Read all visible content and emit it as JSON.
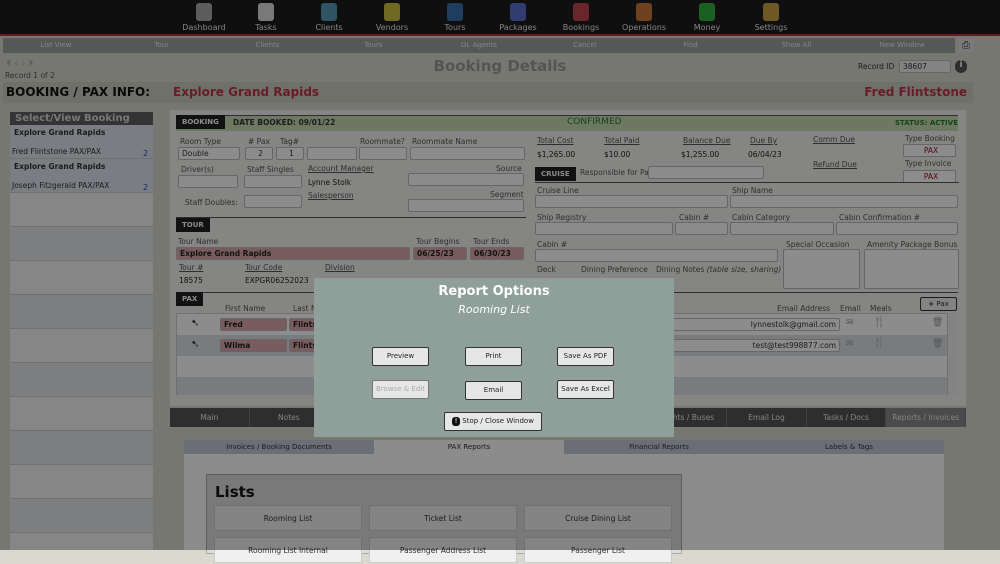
{
  "nav": [
    "Dashboard",
    "Tasks",
    "Clients",
    "Vendors",
    "Tours",
    "Packages",
    "Bookings",
    "Operations",
    "Money",
    "Settings"
  ],
  "nav_colors": [
    "#aaa",
    "#ddd",
    "#5a9ab8",
    "#c8c040",
    "#3a70a8",
    "#5a70c8",
    "#c04850",
    "#c87838",
    "#30b040",
    "#c8a040"
  ],
  "toolbar": [
    "List View",
    "Tour",
    "Clients",
    "Tours",
    "GL Agents",
    "Cancel",
    "Find",
    "Show All",
    "New Window"
  ],
  "page": {
    "title": "Booking Details",
    "record": "Record 1 of 2",
    "record_id_label": "Record ID",
    "record_id": "38607"
  },
  "band": {
    "label": "BOOKING / PAX INFO:",
    "tour": "Explore Grand Rapids",
    "client": "Fred Flintstone"
  },
  "sidebar": {
    "title": "Select/View Booking",
    "items": [
      {
        "tour": "Explore Grand Rapids",
        "name": "Fred Flintstone  PAX/PAX",
        "count": "2"
      },
      {
        "tour": "Explore Grand Rapids",
        "name": "Joseph Fitzgerald  PAX/PAX",
        "count": "2"
      }
    ]
  },
  "booking": {
    "tag": "BOOKING",
    "date_booked": "DATE BOOKED: 09/01/22",
    "confirmed": "CONFIRMED",
    "status": "STATUS: ACTIVE",
    "room_type_label": "Room Type",
    "room_type": "Double",
    "pax_label": "# Pax",
    "pax": "2",
    "tag_label": "Tag#",
    "tag_value": "1",
    "roommate_label": "Roommate?",
    "roommate_name_label": "Roommate Name",
    "drivers_label": "Driver(s)",
    "staff_singles_label": "Staff Singles",
    "staff_doubles_label": "Staff Doubles:",
    "account_manager_label": "Account Manager",
    "account_manager": "Lynne Stolk",
    "salesperson_label": "Salesperson",
    "source_label": "Source",
    "segment_label": "Segment",
    "total_cost_label": "Total Cost",
    "total_cost": "$1,265.00",
    "total_paid_label": "Total  Paid",
    "total_paid": "$10.00",
    "balance_due_label": "Balance Due",
    "balance_due": "$1,255.00",
    "due_by_label": "Due By",
    "due_by": "06/04/23",
    "comm_due_label": "Comm Due",
    "refund_due_label": "Refund Due",
    "type_booking_label": "Type Booking",
    "type_booking": "PAX",
    "type_invoice_label": "Type Invoice",
    "type_invoice": "PAX"
  },
  "tour": {
    "tag": "TOUR",
    "name_label": "Tour Name",
    "name": "Explore Grand Rapids",
    "begins_label": "Tour Begins",
    "begins": "06/25/23",
    "ends_label": "Tour Ends",
    "ends": "06/30/23",
    "num_label": "Tour #",
    "num": "18575",
    "code_label": "Tour Code",
    "code": "EXPGR06252023",
    "division_label": "Division"
  },
  "cruise": {
    "tag": "CRUISE",
    "responsible_label": "Responsible for Payment:",
    "cruise_line": "Cruise Line",
    "ship_name": "Ship Name",
    "ship_registry": "Ship Registry",
    "cabin_num": "Cabin #",
    "cabin_category": "Cabin Category",
    "cabin_conf": "Cabin Confirmation #",
    "cabin_num2": "Cabin #",
    "special": "Special Occasion",
    "amenity": "Amenity Package Bonus",
    "deck": "Deck",
    "dining_pref": "Dining Preference",
    "dining_notes": "Dining Notes",
    "dining_notes_hint": "(table size, sharing)"
  },
  "pax": {
    "tag": "PAX",
    "first_label": "First Name",
    "last_label": "Last N",
    "email_label": "Email Address",
    "email_col": "Email",
    "meals_col": "Meals",
    "add_label": "Pax",
    "rows": [
      {
        "first": "Fred",
        "last": "Flints",
        "email": "lynnestolk@gmail.com"
      },
      {
        "first": "Wilma",
        "last": "Flints",
        "email": "test@test998877.com"
      }
    ]
  },
  "tabs": [
    "Main",
    "Notes",
    "",
    "",
    "",
    "",
    "Flights / Buses",
    "Email Log",
    "Tasks / Docs",
    "Reports / Invoices"
  ],
  "subtabs": [
    "Invoices / Booking Documents",
    "PAX Reports",
    "Financial Reports",
    "Labels & Tags"
  ],
  "lists": {
    "title": "Lists",
    "buttons": [
      "Rooming List",
      "Ticket List",
      "Cruise Dining List",
      "Rooming List Internal",
      "Passenger Address List",
      "Passenger List"
    ]
  },
  "modal": {
    "title": "Report Options",
    "subtitle": "Rooming List",
    "preview": "Preview",
    "print": "Print",
    "pdf": "Save As PDF",
    "browse": "Browse & Edit",
    "email": "Email",
    "excel": "Save As Excel",
    "stop": "Stop / Close Window"
  }
}
